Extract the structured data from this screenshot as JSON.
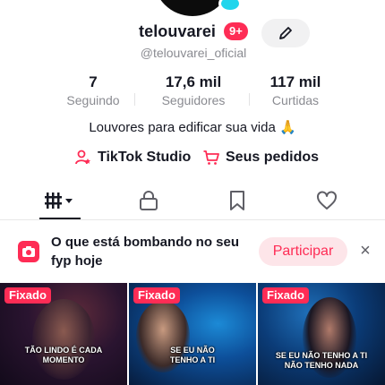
{
  "profile": {
    "username": "telouvarei",
    "notif_badge": "9+",
    "handle": "@telouvarei_oficial",
    "bio": "Louvores para edificar sua vida 🙏"
  },
  "stats": [
    {
      "value": "7",
      "label": "Seguindo"
    },
    {
      "value": "17,6 mil",
      "label": "Seguidores"
    },
    {
      "value": "117 mil",
      "label": "Curtidas"
    }
  ],
  "links": {
    "studio": "TikTok Studio",
    "orders": "Seus pedidos"
  },
  "tabs": [
    "videos-grid-icon",
    "lock-icon",
    "bookmark-icon",
    "heart-icon"
  ],
  "banner": {
    "text": "O que está bombando no seu fyp hoje",
    "button": "Participar",
    "close": "×"
  },
  "videos": [
    {
      "pin": "Fixado",
      "caption": "TÃO LINDO É CADA MOMENTO"
    },
    {
      "pin": "Fixado",
      "caption": "SE EU NÃO TENHO A TI"
    },
    {
      "pin": "Fixado",
      "caption": "SE EU NÃO TENHO A TI NÃO TENHO NADA"
    }
  ],
  "colors": {
    "accent": "#fe2c55",
    "verified": "#20d5ec",
    "muted": "#8a8b91"
  }
}
